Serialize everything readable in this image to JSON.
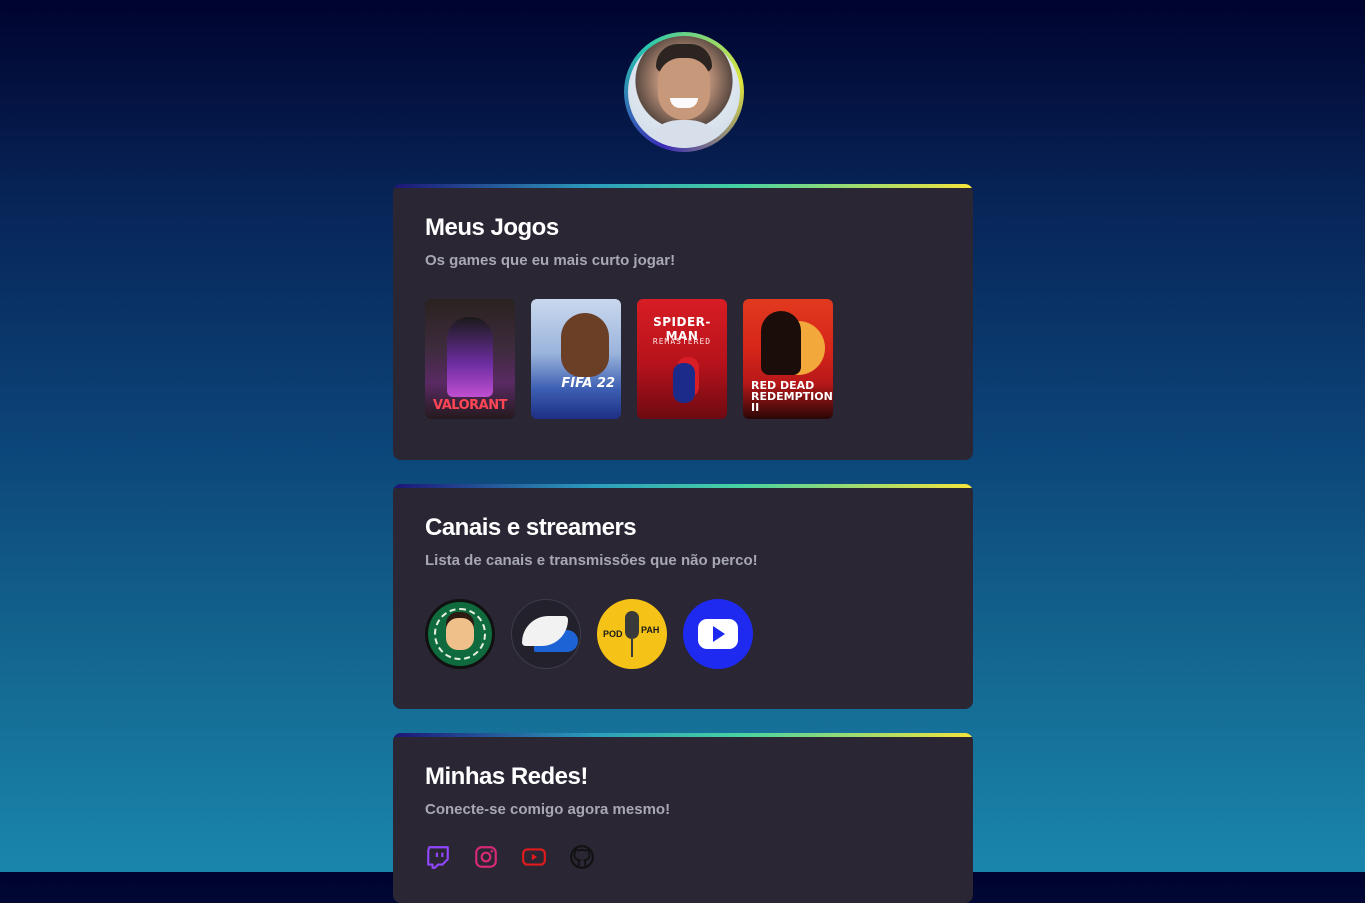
{
  "profile": {
    "avatar_alt": "avatar"
  },
  "games_section": {
    "title": "Meus Jogos",
    "subtitle": "Os games que eu mais curto jogar!",
    "games": [
      {
        "label": "VALORANT"
      },
      {
        "label": "FIFA 22"
      },
      {
        "label": "SPIDER-MAN",
        "sublabel": "REMASTERED"
      },
      {
        "label": "RED DEAD REDEMPTION II"
      }
    ]
  },
  "channels_section": {
    "title": "Canais e streamers",
    "subtitle": "Lista de canais e transmissões que não perco!",
    "channels": [
      {
        "icon": "casimiro-logo-icon"
      },
      {
        "icon": "wings-logo-icon"
      },
      {
        "icon": "podpah-logo-icon",
        "text_left": "POD",
        "text_right": "PAH"
      },
      {
        "icon": "youtube-play-logo-icon"
      }
    ]
  },
  "socials_section": {
    "title": "Minhas Redes!",
    "subtitle": "Conecte-se comigo agora mesmo!",
    "links": [
      {
        "icon": "twitch-icon",
        "color": "#9146ff"
      },
      {
        "icon": "instagram-icon",
        "color": "#d62976"
      },
      {
        "icon": "youtube-icon",
        "color": "#e01b1b"
      },
      {
        "icon": "github-icon",
        "color": "#111111"
      }
    ]
  },
  "colors": {
    "card_bg": "#2a2634",
    "subtitle": "#a8a8b3",
    "accent_gradient": [
      "#1d1577",
      "#2c9ebd",
      "#47d3a2",
      "#f5e43c"
    ]
  }
}
